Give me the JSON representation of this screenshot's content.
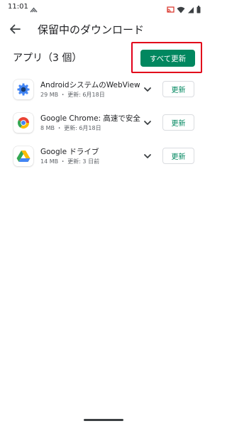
{
  "status_bar": {
    "time": "11:01",
    "icons": [
      "cloud-icon",
      "cast-icon",
      "wifi-icon",
      "signal-icon",
      "battery-icon"
    ]
  },
  "app_bar": {
    "title": "保留中のダウンロード",
    "back_icon": "arrow-back-icon"
  },
  "section": {
    "title": "アプリ（3 個）",
    "update_all_label": "すべて更新",
    "highlight_color": "#e2001a",
    "accent_color": "#01875f"
  },
  "apps": [
    {
      "name": "AndroidシステムのWebView",
      "meta": "29 MB ・ 更新: 6月18日",
      "icon": "webview-gear-icon",
      "update_label": "更新"
    },
    {
      "name": "Google Chrome: 高速で安全",
      "meta": "8 MB ・ 更新: 6月18日",
      "icon": "chrome-icon",
      "update_label": "更新"
    },
    {
      "name": "Google ドライブ",
      "meta": "14 MB ・ 更新: 3 日前",
      "icon": "google-drive-icon",
      "update_label": "更新"
    }
  ]
}
